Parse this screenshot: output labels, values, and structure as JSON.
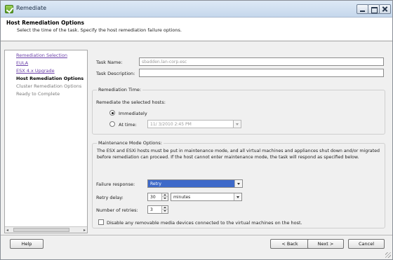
{
  "window": {
    "title": "Remediate",
    "icon": "vsphere-check-icon"
  },
  "header": {
    "title": "Host Remediation Options",
    "subtitle": "Select the time of the task. Specify the host remediation failure options."
  },
  "nav": {
    "items": [
      {
        "label": "Remediation Selection",
        "state": "link"
      },
      {
        "label": "EULA",
        "state": "link"
      },
      {
        "label": "ESX 4.x Upgrade",
        "state": "link"
      },
      {
        "label": "Host Remediation Options",
        "state": "current"
      },
      {
        "label": "Cluster Remediation Options",
        "state": "disabled"
      },
      {
        "label": "Ready to Complete",
        "state": "disabled"
      }
    ]
  },
  "form": {
    "task_name_label": "Task Name:",
    "task_name_value": "sbadden.lan-corp.esc",
    "task_description_label": "Task Description:",
    "task_description_value": ""
  },
  "remediation_time": {
    "group_title": "Remediation Time:",
    "prompt": "Remediate the selected hosts:",
    "immediately_label": "Immediately",
    "at_time_label": "At time:",
    "at_time_value": "11/  3/2010   2:45 PM",
    "selected": "immediately"
  },
  "maintenance": {
    "group_title": "Maintenance Mode Options:",
    "description": "The ESX and ESXi hosts must be put in maintenance mode, and all virtual machines and appliances shut down and/or migrated before remediation can proceed.  If the host cannot enter maintenance mode, the task will respond as specified below.",
    "failure_response_label": "Failure response:",
    "failure_response_value": "Retry",
    "retry_delay_label": "Retry delay:",
    "retry_delay_value": "30",
    "retry_delay_unit": "minutes",
    "retries_label": "Number of retries:",
    "retries_value": "3",
    "disable_media_label": "Disable any removable media devices connected to the virtual machines on the host.",
    "disable_media_checked": false
  },
  "buttons": {
    "help": "Help",
    "back": "< Back",
    "next": "Next >",
    "cancel": "Cancel"
  }
}
